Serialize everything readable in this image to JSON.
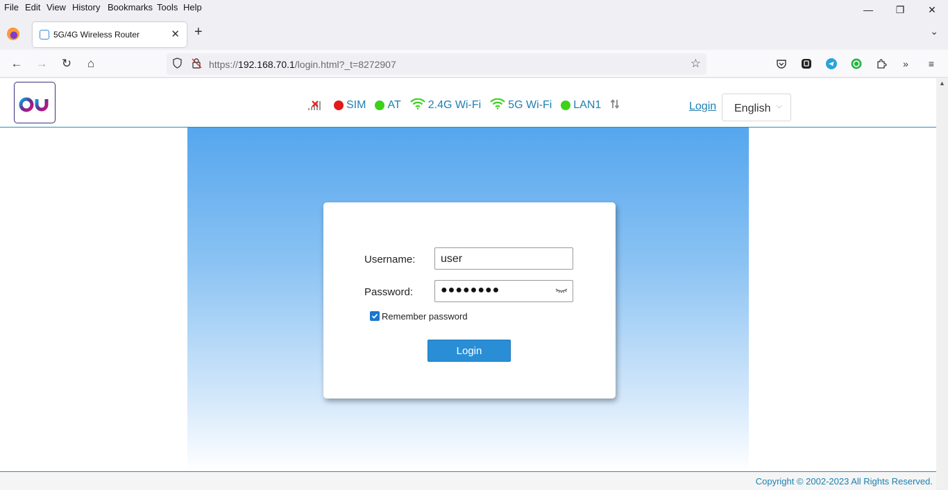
{
  "menubar": {
    "items": [
      "File",
      "Edit",
      "View",
      "History",
      "Bookmarks",
      "Tools",
      "Help"
    ]
  },
  "window_controls": {
    "minimize": "—",
    "restore": "❐",
    "close": "✕"
  },
  "tab": {
    "title": "5G/4G Wireless Router",
    "close": "✕"
  },
  "newtab_label": "+",
  "tablist_label": "⌄",
  "nav": {
    "back": "←",
    "forward": "→",
    "reload": "↻",
    "home": "⌂",
    "url_prefix": "https://",
    "url_host": "192.168.70.1",
    "url_path": "/login.html?_t=8272907"
  },
  "page": {
    "status": {
      "sim": "SIM",
      "at": "AT",
      "wifi24": "2.4G Wi-Fi",
      "wifi5": "5G Wi-Fi",
      "lan": "LAN1",
      "colors": {
        "sim": "#e21a1a",
        "at": "#3cd11b",
        "lan": "#3cd11b",
        "wifi": "#3cd11b",
        "text": "#1d7fb0"
      }
    },
    "login_link": "Login",
    "language": "English",
    "form": {
      "username_label": "Username:",
      "username_value": "user",
      "password_label": "Password:",
      "password_value": "●●●●●●●●",
      "remember_label": "Remember password",
      "remember_checked": true,
      "login_button": "Login"
    },
    "footer": "Copyright © 2002-2023 All Rights Reserved."
  }
}
